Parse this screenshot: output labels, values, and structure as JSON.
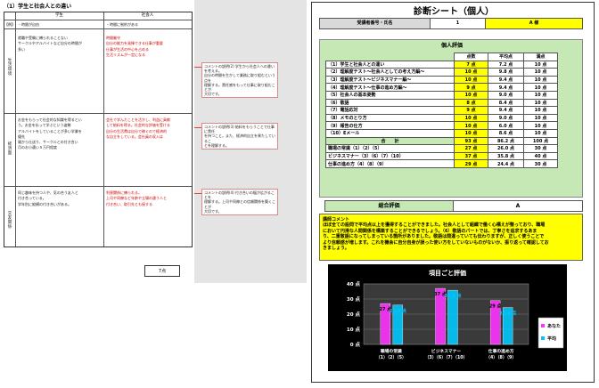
{
  "left_doc": {
    "title": "（1）学生と社会人との違い",
    "col_student": "学生",
    "col_worker": "社会人",
    "row_example": "【例】",
    "ex_student": "・時間が自由",
    "ex_worker": "・時間に制約がある",
    "section_labels": [
      "生活環境",
      "経済面",
      "交友関係"
    ],
    "sec1_student": [
      "就職や受験に縛られることない",
      "サークルやアルバイトなど自分の時間が",
      "多い"
    ],
    "sec1_worker": [
      "時間厳守",
      "自分の能力を発揮できる仕事が重要",
      "仕事が生活の中心を占める",
      "生活リズムが一定になる"
    ],
    "sec2_student": [
      "お金をもらって社会的な知識を得るとい",
      "う。お金を払って学ぶという姿勢",
      "アルバイトをしていることが多い学業を",
      "優先",
      "親から仕送り、サークルとの付き合い",
      "月のお小遣い５万円程度"
    ],
    "sec2_worker": [
      "会社で学んだことを活かし、利益に貢献",
      "して給料を得る。社会的な評価を受ける",
      "自分の生活費は自分で稼ぐので経済的",
      "な自立をしている。会社員の収入は"
    ],
    "sec3_student": [
      "同じ趣味を持つ人や、気の合う友人と",
      "付き合っている。",
      "学年別に縦横の付き合いがある。"
    ],
    "sec3_worker": [
      "利害関係に縛られる。",
      "上司や同僚など年齢や立場の違う人と",
      "付き合い、取引先とも接する"
    ],
    "score_label": "7点"
  },
  "notes": [
    [
      "コメントの説明(2) 学生から社会人への違いを考える。",
      "自分の時間を生かして業務に取り組むという点を",
      "理解する。責任感をもって仕事に取り組むことが",
      "大切です。"
    ],
    [
      "コメントの説明(3) 給料をもらうことで仕事に責任",
      "を持つこと。また、経済的自立を果たしているこ",
      "とを理解する。"
    ],
    [
      "コメントの説明(4) 付き合いの幅が広がることを",
      "理解する。上司や同僚との信頼関係を築くことが",
      "大切です。"
    ]
  ],
  "sheet": {
    "title": "診断シート（個人）",
    "id_label": "受講者番号・氏名",
    "id_number": "1",
    "id_name": "A 様",
    "eval_heading": "個人評価",
    "columns": [
      "点数",
      "平均点",
      "満点"
    ],
    "rows": [
      [
        "（1）学生と社会人との違い",
        "7 点",
        "7.2 点",
        "10 点"
      ],
      [
        "（2）理解度テスト～社会人としての考え方編～",
        "10 点",
        "9.8 点",
        "10 点"
      ],
      [
        "（3）理解度テスト～ビジネスマナー編～",
        "10 点",
        "9.4 点",
        "10 点"
      ],
      [
        "（4）理解度テスト～仕事の進め方編～",
        "9 点",
        "9.4 点",
        "10 点"
      ],
      [
        "（5）社会人の基本姿勢",
        "10 点",
        "9.0 点",
        "10 点"
      ],
      [
        "（6）敬語",
        "8 点",
        "8.4 点",
        "10 点"
      ],
      [
        "（7）電話応対",
        "9 点",
        "9.4 点",
        "10 点"
      ],
      [
        "（8）メモのとり方",
        "10 点",
        "9.0 点",
        "10 点"
      ],
      [
        "（9）報告の仕方",
        "10 点",
        "6.0 点",
        "10 点"
      ],
      [
        "（10）Eメール",
        "10 点",
        "8.6 点",
        "10 点"
      ]
    ],
    "total": [
      "合　　計",
      "93 点",
      "86.2 点",
      "100 点"
    ],
    "subtotals": [
      [
        "職場の常識（1）（2）（5）",
        "27 点",
        "26.0 点",
        "30 点"
      ],
      [
        "ビジネスマナー（3）（6）（7）（10）",
        "37 点",
        "35.8 点",
        "40 点"
      ],
      [
        "仕事の進め方（4）（8）（9）",
        "29 点",
        "24.4 点",
        "30 点"
      ]
    ],
    "overall_label": "総合評価",
    "overall_value": "A",
    "comment_title": "講師コメント",
    "comment_lines": [
      "ほぼ全ての設問で平均点以上を獲得することができました。社会人として組織で働く心構えが整っており、職場",
      "において円滑な人間関係を構築することができるでしょう。（6）敬語のパートでは、丁寧さを追求するあま",
      "り、二重敬語になってしまっている箇所がありました。敬語は間違っていても伝わりますが、正しく使うことで",
      "より信頼感が増します。これを機会に自分自身が誤った使い方をしていないものがないか、振り返って確認してお",
      "きましょう。"
    ]
  },
  "chart_data": {
    "type": "bar",
    "title": "項目ごと評価",
    "categories": [
      "職場の常識（1）（2）（5）",
      "ビジネスマナー（3）（6）（7）（10）",
      "仕事の進め方（4）（8）（9）"
    ],
    "category_lines": [
      [
        "職場の常識",
        "（1）（2）（5）"
      ],
      [
        "ビジネスマナー",
        "（3）（6）（7）（10）"
      ],
      [
        "仕事の進め方",
        "（4）（8）（9）"
      ]
    ],
    "series": [
      {
        "name": "あなた",
        "values": [
          27,
          37,
          29
        ],
        "labels": [
          "27 点",
          "37 点",
          "29 点"
        ],
        "color": "#ff33ff"
      },
      {
        "name": "平均",
        "values": [
          26.0,
          35.8,
          24.4
        ],
        "labels": [
          "26.0 点",
          "35.8 点",
          "24.4 点"
        ],
        "color": "#00c8ff"
      }
    ],
    "yticks": [
      0,
      10,
      20,
      30,
      40
    ],
    "ytick_labels": [
      "0 点",
      "10 点",
      "20 点",
      "30 点",
      "40 点"
    ],
    "ylim": [
      0,
      40
    ],
    "legend_position": "right",
    "grid": true
  }
}
